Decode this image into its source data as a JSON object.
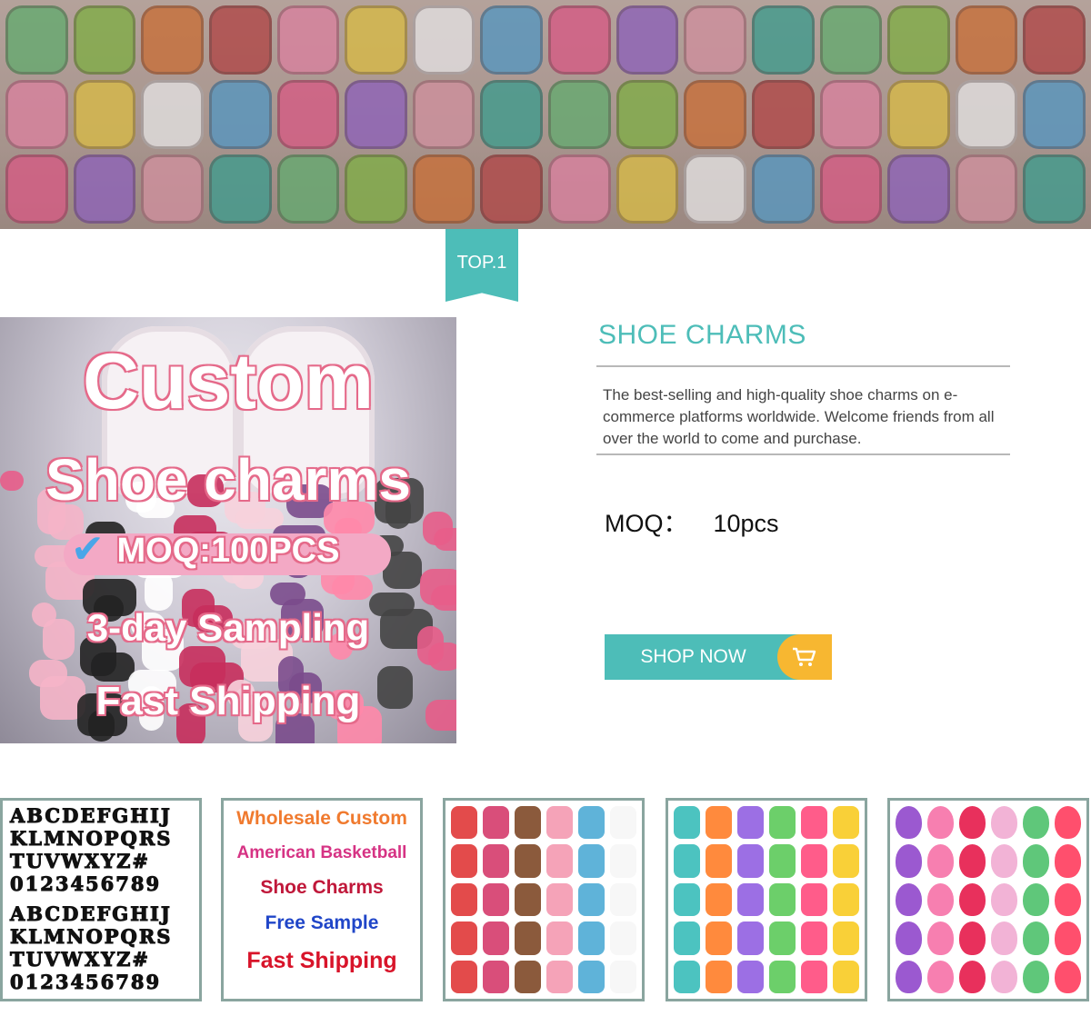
{
  "ribbon": {
    "label": "TOP.1"
  },
  "product_image": {
    "line1": "Custom",
    "line2": "Shoe charms",
    "line3": "MOQ:100PCS",
    "line4": "3-day Sampling",
    "line5": "Fast Shipping"
  },
  "info": {
    "title": "SHOE CHARMS",
    "description": "The best-selling and high-quality shoe charms on e-commerce platforms worldwide. Welcome friends from all over the world to come and purchase.",
    "moq_label": "MOQ：",
    "moq_value": "10pcs",
    "shop_button": "SHOP NOW"
  },
  "thumbnails": {
    "alphabet_rows": [
      "ABCDEFGHIJ",
      "KLMNOPQRS",
      "TUVWXYZ#",
      "0123456789",
      "ABCDEFGHIJ",
      "KLMNOPQRS",
      "TUVWXYZ#",
      "0123456789"
    ],
    "promo_lines": [
      "Wholesale Custom",
      "American Basketball",
      "Shoe Charms",
      "Free Sample",
      "Fast Shipping"
    ]
  },
  "colors": {
    "accent": "#4dbdb8",
    "cart_bg": "#f7b731",
    "thumb_border": "#8aa59f"
  }
}
